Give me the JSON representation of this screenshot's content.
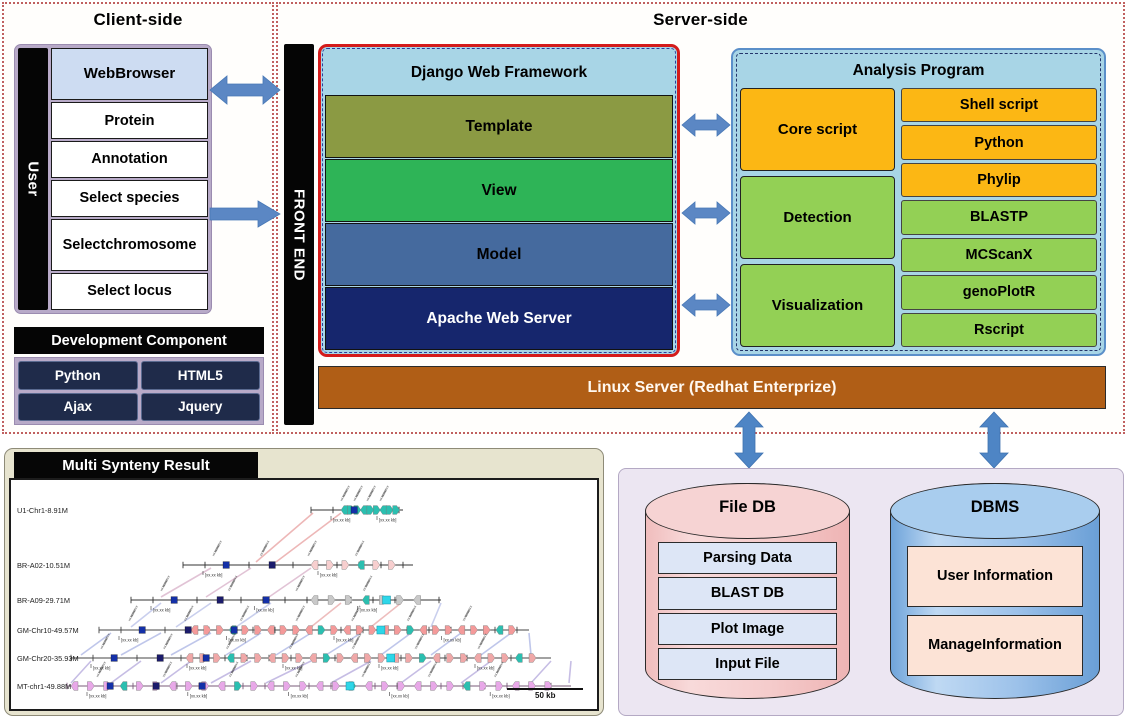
{
  "client": {
    "title": "Client-side",
    "user_label": "User",
    "items": [
      {
        "label": "Web\nBrowser",
        "highlight": true
      },
      {
        "label": "Protein",
        "highlight": false
      },
      {
        "label": "Annotation",
        "highlight": false
      },
      {
        "label": "Select species",
        "highlight": false
      },
      {
        "label": "Select\nchromosome",
        "highlight": false
      },
      {
        "label": "Select locus",
        "highlight": false
      }
    ],
    "dev_component": {
      "header": "Development Component",
      "cells": [
        "Python",
        "HTML5",
        "Ajax",
        "Jquery"
      ]
    }
  },
  "server": {
    "title": "Server-side",
    "front_end_label": "FRONT END",
    "django": {
      "title": "Django Web Framework",
      "layers": [
        {
          "label": "Template",
          "color": "#8b9a43",
          "text_color": "#000000"
        },
        {
          "label": "View",
          "color": "#2eb457",
          "text_color": "#000000"
        },
        {
          "label": "Model",
          "color": "#456a9e",
          "text_color": "#000000"
        },
        {
          "label": "Apache Web Server",
          "color": "#16266d",
          "text_color": "#ffffff"
        }
      ]
    },
    "analysis": {
      "title": "Analysis Program",
      "stages": [
        {
          "label": "Core script",
          "color": "#fcb714"
        },
        {
          "label": "Detection",
          "color": "#93d055"
        },
        {
          "label": "Visualization",
          "color": "#93d055"
        }
      ],
      "tools": [
        {
          "label": "Shell script",
          "color": "#fcb714"
        },
        {
          "label": "Python",
          "color": "#fcb714"
        },
        {
          "label": "Phylip",
          "color": "#fcb714"
        },
        {
          "label": "BLASTP",
          "color": "#93d055"
        },
        {
          "label": "MCScanX",
          "color": "#93d055"
        },
        {
          "label": "genoPlotR",
          "color": "#93d055"
        },
        {
          "label": "Rscript",
          "color": "#93d055"
        }
      ]
    },
    "linux_label": "Linux Server (Redhat Enterprize)"
  },
  "synteny": {
    "header": "Multi Synteny Result",
    "scalebar": "50 kb",
    "rows": [
      "U1-Chr1-8.91M",
      "BR-A02-10.51M",
      "BR-A09-29.71M",
      "GM-Chr10-49.57M",
      "GM-Chr20-35.93M",
      "MT-chr1-49.88M"
    ]
  },
  "databases": [
    {
      "title": "File DB",
      "items": [
        "Parsing Data",
        "BLAST DB",
        "Plot Image",
        "Input File"
      ]
    },
    {
      "title": "DBMS",
      "items": [
        "User Information",
        "Manage\nInformation"
      ]
    }
  ],
  "colors": {
    "accent_arrow": "#5b87c4",
    "region_border": "#c06060",
    "django_border": "#d41b1b",
    "linux_bg": "#b05e16",
    "django_header": "#a8d5e6"
  }
}
